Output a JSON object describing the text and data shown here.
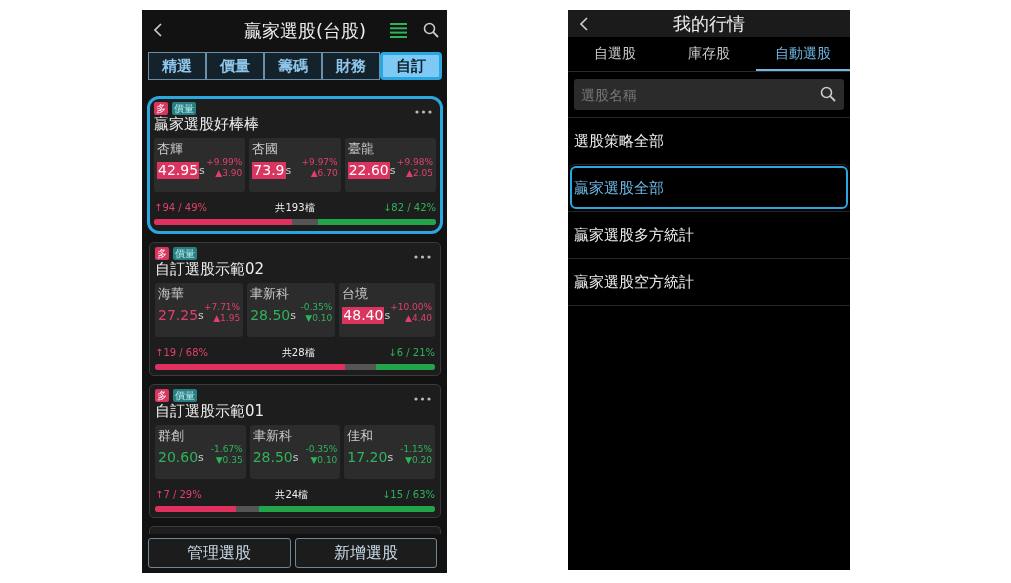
{
  "left_screen": {
    "title": "贏家選股(台股)",
    "tabs": [
      {
        "label": "精選",
        "selected": false,
        "highlighted": false
      },
      {
        "label": "價量",
        "selected": false,
        "highlighted": false
      },
      {
        "label": "籌碼",
        "selected": false,
        "highlighted": false
      },
      {
        "label": "財務",
        "selected": false,
        "highlighted": false
      },
      {
        "label": "自訂",
        "selected": true,
        "highlighted": true
      }
    ],
    "cards": [
      {
        "tags": [
          "多",
          "價量"
        ],
        "name": "贏家選股好棒棒",
        "highlighted": true,
        "stocks": [
          {
            "name": "杏輝",
            "price": "42.95",
            "suffix": "s",
            "pct": "+9.99%",
            "change": "▲3.90",
            "rising": true,
            "limit": true
          },
          {
            "name": "杏國",
            "price": "73.9",
            "suffix": "s",
            "pct": "+9.97%",
            "change": "▲6.70",
            "rising": true,
            "limit": true
          },
          {
            "name": "臺龍",
            "price": "22.60",
            "suffix": "s",
            "pct": "+9.98%",
            "change": "▲2.05",
            "rising": true,
            "limit": true
          }
        ],
        "up_count": "↑94 / 49%",
        "total": "共193檔",
        "down_count": "↓82 / 42%",
        "up_bar": {
          "level": 0.49
        },
        "down_bar": {
          "level": 0.42
        }
      },
      {
        "tags": [
          "多",
          "價量"
        ],
        "name": "自訂選股示範02",
        "highlighted": false,
        "stocks": [
          {
            "name": "海華",
            "price": "27.25",
            "suffix": "s",
            "pct": "+7.71%",
            "change": "▲1.95",
            "rising": true,
            "limit": false
          },
          {
            "name": "聿新科",
            "price": "28.50",
            "suffix": "s",
            "pct": "-0.35%",
            "change": "▼0.10",
            "rising": false,
            "limit": false
          },
          {
            "name": "台境",
            "price": "48.40",
            "suffix": "s",
            "pct": "+10.00%",
            "change": "▲4.40",
            "rising": true,
            "limit": true
          }
        ],
        "up_count": "↑19 / 68%",
        "total": "共28檔",
        "down_count": "↓6 / 21%",
        "up_bar": {
          "level": 0.68
        },
        "down_bar": {
          "level": 0.21
        }
      },
      {
        "tags": [
          "多",
          "價量"
        ],
        "name": "自訂選股示範01",
        "highlighted": false,
        "stocks": [
          {
            "name": "群創",
            "price": "20.60",
            "suffix": "s",
            "pct": "-1.67%",
            "change": "▼0.35",
            "rising": false,
            "limit": false
          },
          {
            "name": "聿新科",
            "price": "28.50",
            "suffix": "s",
            "pct": "-0.35%",
            "change": "▼0.10",
            "rising": false,
            "limit": false
          },
          {
            "name": "佳和",
            "price": "17.20",
            "suffix": "s",
            "pct": "-1.15%",
            "change": "▼0.20",
            "rising": false,
            "limit": false
          }
        ],
        "up_count": "↑7 / 29%",
        "total": "共24檔",
        "down_count": "↓15 / 63%",
        "up_bar": {
          "level": 0.29
        },
        "down_bar": {
          "level": 0.63
        }
      }
    ],
    "buttons": [
      "管理選股",
      "新增選股"
    ]
  },
  "right_screen": {
    "title": "我的行情",
    "tabs": [
      {
        "label": "自選股",
        "selected": false
      },
      {
        "label": "庫存股",
        "selected": false
      },
      {
        "label": "自動選股",
        "selected": true
      }
    ],
    "search": {
      "placeholder": "選股名稱"
    },
    "items": [
      {
        "label": "選股策略全部",
        "selected": false
      },
      {
        "label": "贏家選股全部",
        "selected": true
      },
      {
        "label": "贏家選股多方統計",
        "selected": false
      },
      {
        "label": "贏家選股空方統計",
        "selected": false
      }
    ]
  }
}
